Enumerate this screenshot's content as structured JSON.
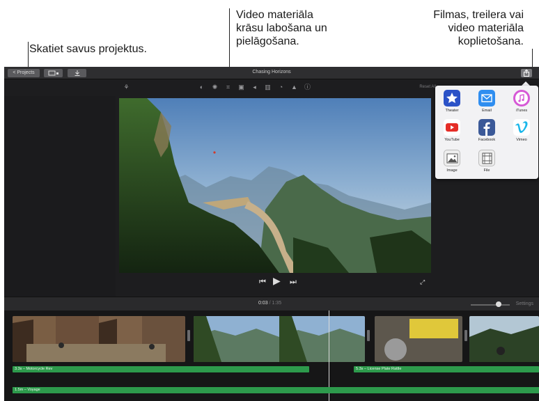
{
  "callouts": {
    "projects": "Skatiet savus projektus.",
    "adjust_line1": "Video materiāla",
    "adjust_line2": "krāsu labošana un",
    "adjust_line3": "pielāgošana.",
    "share_line1": "Filmas, treilera vai",
    "share_line2": "video materiāla",
    "share_line3": "koplietošana."
  },
  "titlebar": {
    "back_label": "< Projects",
    "title": "Chasing Horizons"
  },
  "toolbar": {
    "reset_all": "Reset All"
  },
  "timeline": {
    "current_time": "0:03",
    "separator": " / ",
    "duration": "1:35",
    "settings_label": "Settings",
    "zoom_level": 0.65,
    "clip1_label": "3.3s – Motorcycle Rev",
    "clip2_label": "5.3s – License Plate Rattle",
    "music_label": "1.5m – Voyage"
  },
  "share_menu": {
    "items": [
      {
        "label": "Theater",
        "icon": "theater-icon",
        "color": "#2b52c7"
      },
      {
        "label": "Email",
        "icon": "email-icon",
        "color": "#2f8ef0"
      },
      {
        "label": "iTunes",
        "icon": "itunes-icon",
        "color": "#d658d6"
      },
      {
        "label": "YouTube",
        "icon": "youtube-icon",
        "color": "#e52d27"
      },
      {
        "label": "Facebook",
        "icon": "facebook-icon",
        "color": "#3b5998"
      },
      {
        "label": "Vimeo",
        "icon": "vimeo-icon",
        "color": "#1ab7ea"
      },
      {
        "label": "Image",
        "icon": "image-icon",
        "color": "#eeeeee"
      },
      {
        "label": "File",
        "icon": "file-icon",
        "color": "#eeeeee"
      }
    ]
  },
  "colors": {
    "accent_green": "#2d9a4c",
    "app_background": "#1d1d1f"
  }
}
